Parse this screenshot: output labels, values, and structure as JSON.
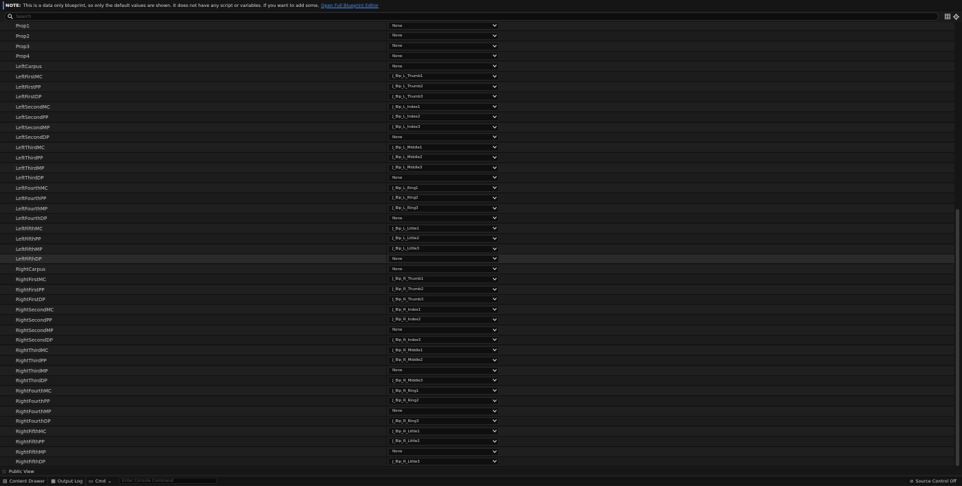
{
  "note": {
    "prefix": "NOTE:",
    "text": "This is a data only blueprint, so only the default values are shown.  It does not have any script or variables.  If you want to add some,",
    "link": "Open Full Blueprint Editor"
  },
  "search": {
    "placeholder": "Search"
  },
  "properties": [
    {
      "name": "Prop1",
      "value": "None"
    },
    {
      "name": "Prop2",
      "value": "None"
    },
    {
      "name": "Prop3",
      "value": "None"
    },
    {
      "name": "Prop4",
      "value": "None"
    },
    {
      "name": "LeftCarpus",
      "value": "None"
    },
    {
      "name": "LeftFirstMC",
      "value": "J_Bip_L_Thumb1"
    },
    {
      "name": "LeftFirstPP",
      "value": "J_Bip_L_Thumb2"
    },
    {
      "name": "LeftFirstDP",
      "value": "J_Bip_L_Thumb3"
    },
    {
      "name": "LeftSecondMC",
      "value": "J_Bip_L_Index1"
    },
    {
      "name": "LeftSecondPP",
      "value": "J_Bip_L_Index2"
    },
    {
      "name": "LeftSecondMP",
      "value": "J_Bip_L_Index3"
    },
    {
      "name": "LeftSecondDP",
      "value": "None"
    },
    {
      "name": "LeftThirdMC",
      "value": "J_Bip_L_Middle1"
    },
    {
      "name": "LeftThirdPP",
      "value": "J_Bip_L_Middle2"
    },
    {
      "name": "LeftThirdMP",
      "value": "J_Bip_L_Middle3"
    },
    {
      "name": "LeftThirdDP",
      "value": "None"
    },
    {
      "name": "LeftFourthMC",
      "value": "J_Bip_L_Ring1"
    },
    {
      "name": "LeftFourthPP",
      "value": "J_Bip_L_Ring2"
    },
    {
      "name": "LeftFourthMP",
      "value": "J_Bip_L_Ring3"
    },
    {
      "name": "LeftFourthDP",
      "value": "None"
    },
    {
      "name": "LeftFifthMC",
      "value": "J_Bip_L_Little1"
    },
    {
      "name": "LeftFifthPP",
      "value": "J_Bip_L_Little2"
    },
    {
      "name": "LeftFifthMP",
      "value": "J_Bip_L_Little3"
    },
    {
      "name": "LeftFifthDP",
      "value": "None",
      "highlighted": true
    },
    {
      "name": "RightCarpus",
      "value": "None"
    },
    {
      "name": "RightFirstMC",
      "value": "J_Bip_R_Thumb1"
    },
    {
      "name": "RightFirstPP",
      "value": "J_Bip_R_Thumb2"
    },
    {
      "name": "RightFirstDP",
      "value": "J_Bip_R_Thumb3"
    },
    {
      "name": "RightSecondMC",
      "value": "J_Bip_R_Index1"
    },
    {
      "name": "RightSecondPP",
      "value": "J_Bip_R_Index2"
    },
    {
      "name": "RightSecondMP",
      "value": "None"
    },
    {
      "name": "RightSecondDP",
      "value": "J_Bip_R_Index3"
    },
    {
      "name": "RightThirdMC",
      "value": "J_Bip_R_Middle1"
    },
    {
      "name": "RightThirdPP",
      "value": "J_Bip_R_Middle2"
    },
    {
      "name": "RightThirdMP",
      "value": "None"
    },
    {
      "name": "RightThirdDP",
      "value": "J_Bip_R_Middle3"
    },
    {
      "name": "RightFourthMC",
      "value": "J_Bip_R_Ring1"
    },
    {
      "name": "RightFourthPP",
      "value": "J_Bip_R_Ring2"
    },
    {
      "name": "RightFourthMP",
      "value": "None"
    },
    {
      "name": "RightFourthDP",
      "value": "J_Bip_R_Ring3"
    },
    {
      "name": "RightFifthMC",
      "value": "J_Bip_R_Little1"
    },
    {
      "name": "RightFifthPP",
      "value": "J_Bip_R_Little2"
    },
    {
      "name": "RightFifthMP",
      "value": "None"
    },
    {
      "name": "RightFifthDP",
      "value": "J_Bip_R_Little3"
    }
  ],
  "footer": {
    "public_view": "Public View"
  },
  "status_bar": {
    "content_drawer": "Content Drawer",
    "output_log": "Output Log",
    "cmd": "Cmd",
    "console_placeholder": "Enter Console Command",
    "source_control": "Source Control Off"
  },
  "colors": {
    "accent": "#3b7be6",
    "link": "#4c8ff5"
  }
}
